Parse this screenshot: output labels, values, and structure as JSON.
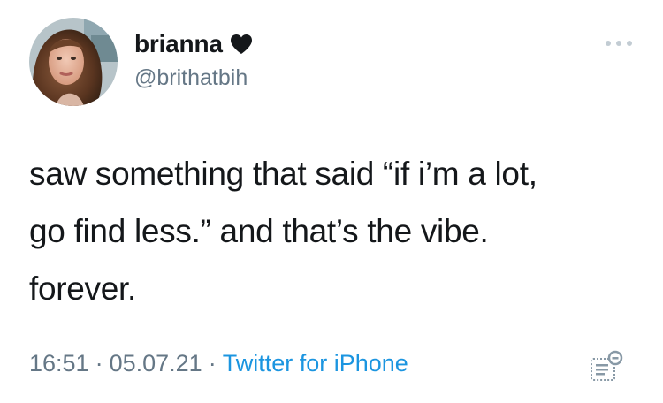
{
  "tweet": {
    "display_name": "brianna",
    "badge_icon": "heart-icon",
    "handle": "@brithatbih",
    "text_lines": [
      "saw something that said “if i’m a lot,",
      "go find less.” and that’s the vibe.",
      "forever."
    ],
    "time": "16:51",
    "separator": "·",
    "date": "05.07.21",
    "source": "Twitter for iPhone"
  },
  "icons": {
    "more": "more-options-icon",
    "analytics": "analytics-icon",
    "avatar": "avatar"
  },
  "colors": {
    "text": "#14171a",
    "secondary": "#657786",
    "link": "#1b95e0"
  }
}
